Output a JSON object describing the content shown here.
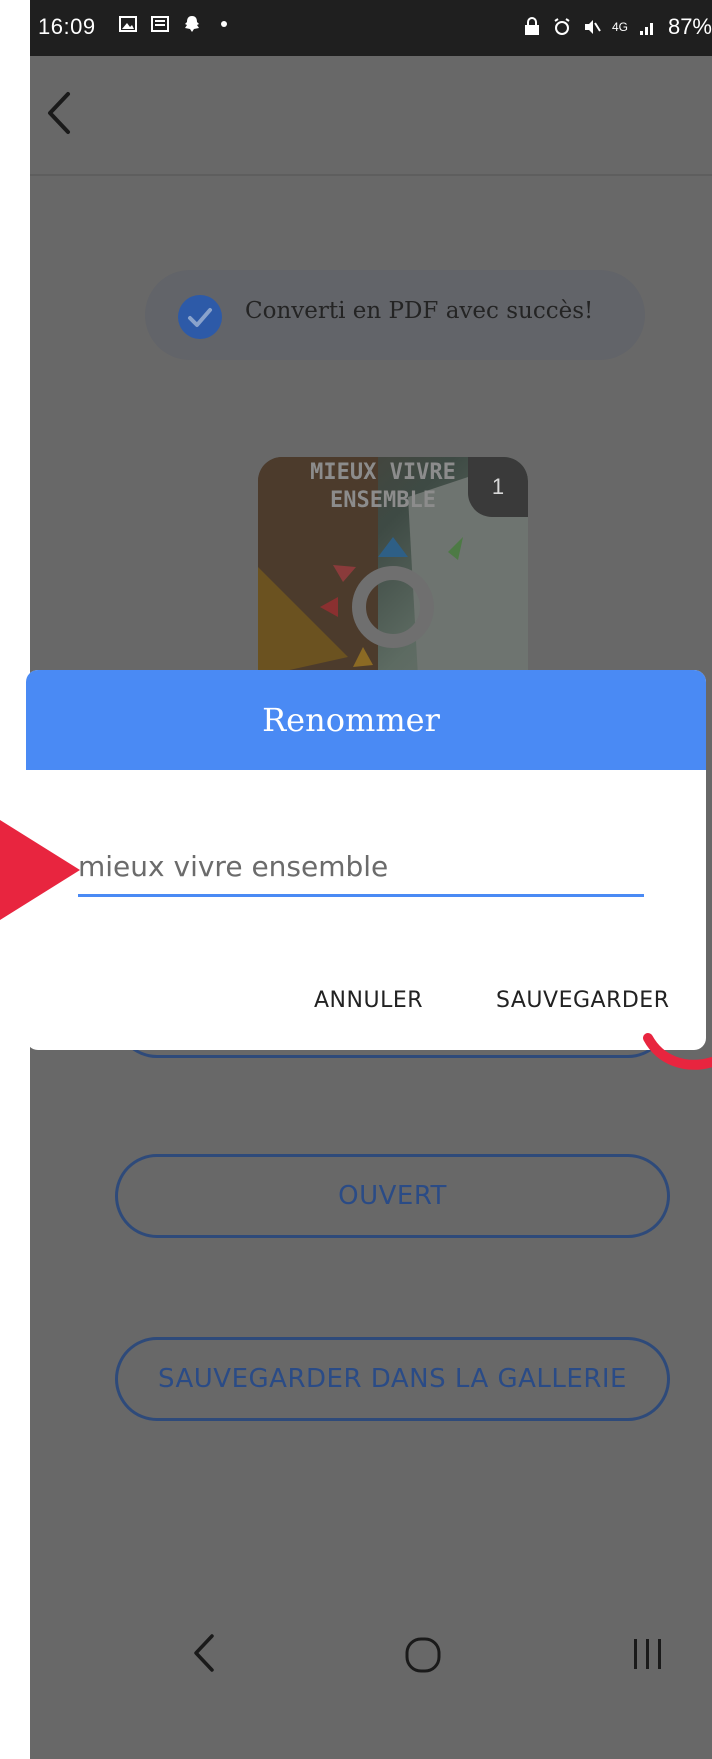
{
  "status_bar": {
    "time": "16:09",
    "network": "4G",
    "battery": "87%"
  },
  "success_message": "Converti en PDF avec succès!",
  "thumbnail": {
    "title": "MIEUX VIVRE ENSEMBLE",
    "page_badge": "1"
  },
  "dialog": {
    "title": "Renommer",
    "input_value": "mieux vivre ensemble",
    "cancel_label": "ANNULER",
    "save_label": "SAUVEGARDER"
  },
  "buttons": {
    "open_label": "OUVERT",
    "save_gallery_label": "SAUVEGARDER DANS LA GALLERIE"
  },
  "colors": {
    "accent": "#4a8af4",
    "annotation": "#e8253f",
    "scrim": "#686868"
  },
  "icons": [
    "back-arrow-icon",
    "check-circle-icon",
    "nav-back-icon",
    "nav-home-icon",
    "nav-recents-icon"
  ]
}
